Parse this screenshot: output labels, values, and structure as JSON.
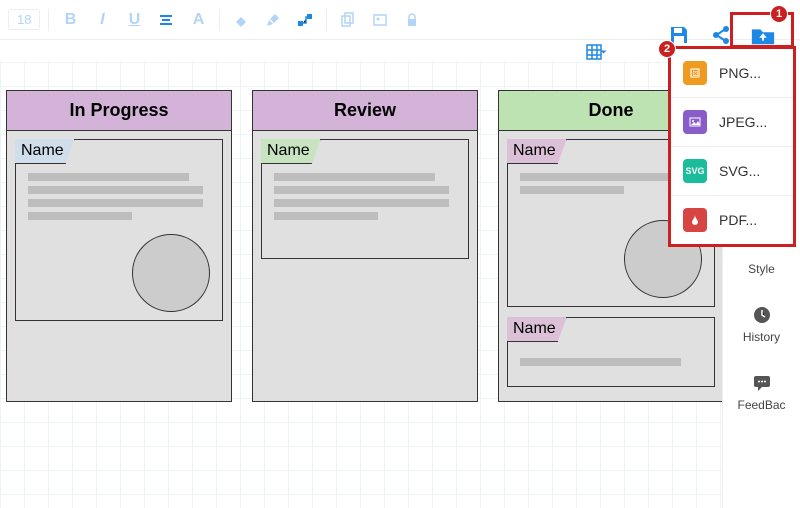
{
  "toolbar": {
    "fontsize": "18"
  },
  "columns": [
    {
      "title": "In Progress",
      "header_class": "hdr-purple",
      "cards": [
        {
          "tab": "Name",
          "tab_class": "tab-blue",
          "lines": 4,
          "circle": true,
          "size": "tall"
        }
      ]
    },
    {
      "title": "Review",
      "header_class": "hdr-purple",
      "cards": [
        {
          "tab": "Name",
          "tab_class": "tab-green",
          "lines": 4,
          "circle": false,
          "size": "med"
        }
      ]
    },
    {
      "title": "Done",
      "header_class": "hdr-green",
      "cards": [
        {
          "tab": "Name",
          "tab_class": "tab-pink",
          "lines": 2,
          "circle": true,
          "size": "tall"
        },
        {
          "tab": "Name",
          "tab_class": "tab-pink",
          "lines": 1,
          "circle": false,
          "size": "small"
        }
      ]
    }
  ],
  "export_menu": {
    "items": [
      {
        "label": "PNG...",
        "icon_class": "f-orange",
        "icon_text": ""
      },
      {
        "label": "JPEG...",
        "icon_class": "f-purple",
        "icon_text": ""
      },
      {
        "label": "SVG...",
        "icon_class": "f-teal",
        "icon_text": "SVG"
      },
      {
        "label": "PDF...",
        "icon_class": "f-red",
        "icon_text": ""
      }
    ]
  },
  "right_rail": {
    "items": [
      {
        "label": "Style",
        "icon": "style"
      },
      {
        "label": "History",
        "icon": "history"
      },
      {
        "label": "FeedBac",
        "icon": "feedback"
      }
    ]
  },
  "badges": {
    "b1": "1",
    "b2": "2"
  }
}
